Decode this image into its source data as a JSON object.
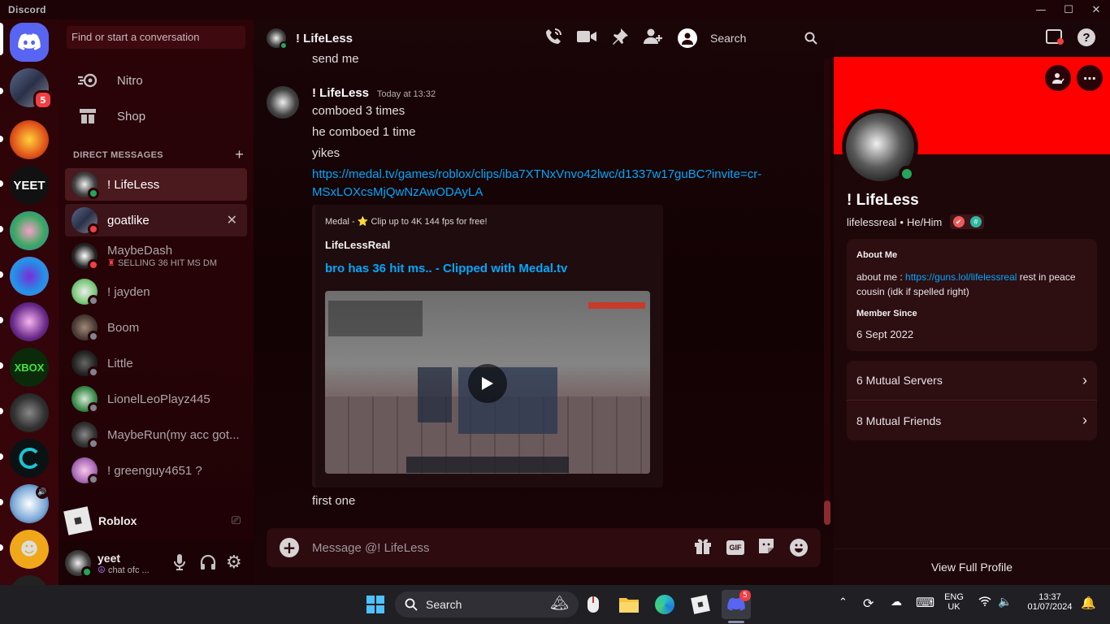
{
  "app": {
    "title": "Discord"
  },
  "window_controls": {
    "minimize": "—",
    "maximize": "☐",
    "close": "✕"
  },
  "rail": {
    "home_badge": "",
    "server1_badge": "5"
  },
  "sidebar": {
    "search_placeholder": "Find or start a conversation",
    "nitro": "Nitro",
    "shop": "Shop",
    "dm_header": "DIRECT MESSAGES",
    "dm_add": "+",
    "dms": [
      {
        "name": "! LifeLess",
        "status": "online",
        "sub": ""
      },
      {
        "name": "goatlike",
        "status": "dnd",
        "sub": ""
      },
      {
        "name": "MaybeDash",
        "status": "dnd",
        "sub": "SELLING 36 HIT MS DM"
      },
      {
        "name": "! jayden",
        "status": "off",
        "sub": ""
      },
      {
        "name": "Boom",
        "status": "off",
        "sub": ""
      },
      {
        "name": "Little",
        "status": "off",
        "sub": ""
      },
      {
        "name": "LionelLeoPlayz445",
        "status": "off",
        "sub": ""
      },
      {
        "name": "MaybeRun(my acc got...",
        "status": "off",
        "sub": ""
      },
      {
        "name": "! greenguy4651 ?",
        "status": "off",
        "sub": ""
      }
    ],
    "activity": "Roblox",
    "user": {
      "name": "yeet",
      "status": "chat ofc ..."
    }
  },
  "chat": {
    "channel": "! LifeLess",
    "search_placeholder": "Search",
    "prev_line": "send me",
    "author": "! LifeLess",
    "timestamp": "Today at 13:32",
    "lines": [
      "comboed 3 times",
      "he comboed 1 time",
      "yikes"
    ],
    "link_l1": "https://medal.tv/games/roblox/clips/iba7XTNxVnvo42lwc/d1337w17guBC?invite=cr-",
    "link_l2": "MSxLOXcsMjQwNzAwODAyLA",
    "embed": {
      "provider": "Medal - ⭐ Clip up to 4K 144 fps for free!",
      "author": "LifeLessReal",
      "title": "bro has 36 hit ms.. - Clipped with Medal.tv"
    },
    "last_line": "first one",
    "composer_placeholder": "Message @! LifeLess"
  },
  "profile": {
    "display_name": "! LifeLess",
    "username": "lifelessreal",
    "pronouns": "He/Him",
    "about_heading": "About Me",
    "about_prefix": "about me : ",
    "about_link": "https://guns.lol/lifelessreal",
    "about_suffix": " rest in peace cousin (idk if spelled right)",
    "member_heading": "Member Since",
    "member_since": "6 Sept 2022",
    "mutual_servers": "6 Mutual Servers",
    "mutual_friends": "8 Mutual Friends",
    "view_full": "View Full Profile",
    "banner_color": "#ff0000"
  },
  "taskbar": {
    "search": "Search",
    "discord_badge": "5",
    "lang1": "ENG",
    "lang2": "UK",
    "time": "13:37",
    "date": "01/07/2024"
  }
}
